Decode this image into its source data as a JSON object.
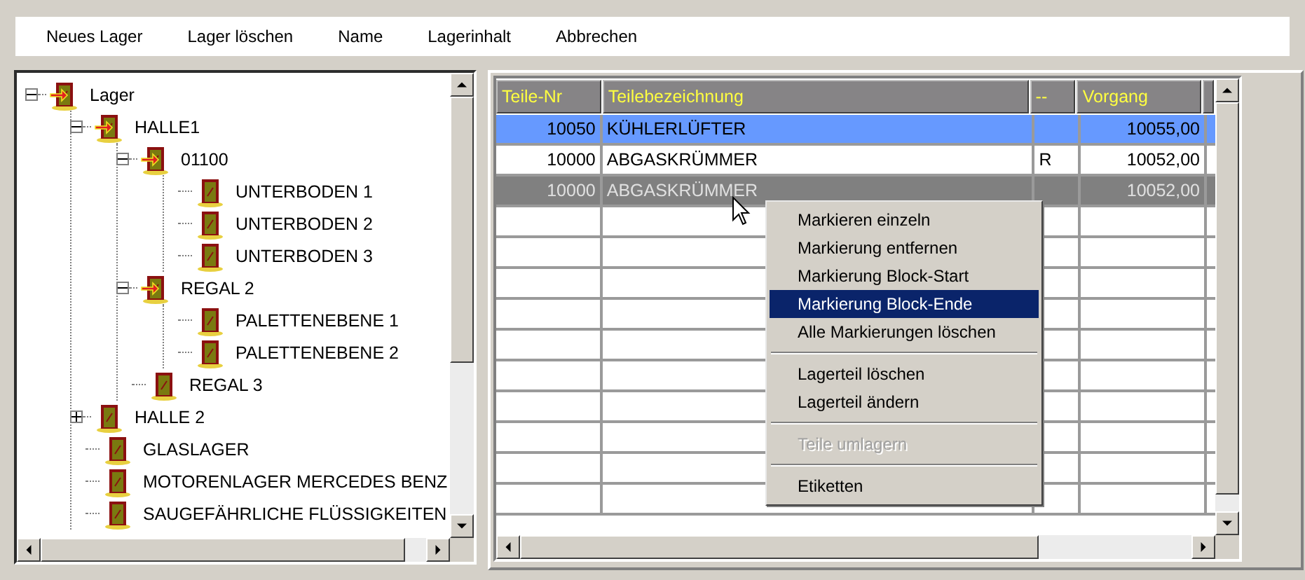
{
  "toolbar": [
    "Neues Lager",
    "Lager löschen",
    "Name",
    "Lagerinhalt",
    "Abbrechen"
  ],
  "tree": [
    {
      "label": "Lager",
      "kind": "branch",
      "expanded": true,
      "children": [
        {
          "label": "HALLE1",
          "kind": "branch",
          "expanded": true,
          "children": [
            {
              "label": "01100",
              "kind": "branch",
              "expanded": true,
              "children": [
                {
                  "label": "UNTERBODEN 1",
                  "kind": "leaf"
                },
                {
                  "label": "UNTERBODEN 2",
                  "kind": "leaf"
                },
                {
                  "label": "UNTERBODEN 3",
                  "kind": "leaf"
                }
              ]
            },
            {
              "label": "REGAL 2",
              "kind": "branch",
              "expanded": true,
              "children": [
                {
                  "label": "PALETTENEBENE 1",
                  "kind": "leaf"
                },
                {
                  "label": "PALETTENEBENE 2",
                  "kind": "leaf"
                }
              ]
            },
            {
              "label": "REGAL 3",
              "kind": "leaf"
            }
          ]
        },
        {
          "label": "HALLE 2",
          "kind": "branch",
          "expanded": false
        },
        {
          "label": "GLASLAGER",
          "kind": "leaf"
        },
        {
          "label": "MOTORENLAGER MERCEDES BENZ",
          "kind": "leaf"
        },
        {
          "label": "SAUGEFÄHRLICHE FLÜSSIGKEITEN",
          "kind": "leaf"
        }
      ]
    }
  ],
  "table": {
    "columns": [
      "Teile-Nr",
      "Teilebezeichnung",
      "--",
      "Vorgang"
    ],
    "rows": [
      {
        "nr": "10050",
        "name": "KÜHLERLÜFTER",
        "vorgang": "10055,00",
        "selected": true,
        "marked": false
      },
      {
        "nr": "10000",
        "name": "ABGASKRÜMMER",
        "flag": "R",
        "vorgang": "10052,00",
        "selected": false,
        "marked": false
      },
      {
        "nr": "10000",
        "name": "ABGASKRÜMMER",
        "vorgang": "10052,00",
        "selected": false,
        "marked": true
      }
    ]
  },
  "context_menu": [
    {
      "kind": "item",
      "label": "Markieren einzeln",
      "selected": false,
      "disabled": false
    },
    {
      "kind": "item",
      "label": "Markierung entfernen",
      "selected": false,
      "disabled": false
    },
    {
      "kind": "item",
      "label": "Markierung Block-Start",
      "selected": false,
      "disabled": false
    },
    {
      "kind": "item",
      "label": "Markierung Block-Ende",
      "selected": true,
      "disabled": false
    },
    {
      "kind": "item",
      "label": "Alle Markierungen löschen",
      "selected": false,
      "disabled": false
    },
    {
      "kind": "separator"
    },
    {
      "kind": "item",
      "label": "Lagerteil löschen",
      "selected": false,
      "disabled": false
    },
    {
      "kind": "item",
      "label": "Lagerteil ändern",
      "selected": false,
      "disabled": false
    },
    {
      "kind": "separator"
    },
    {
      "kind": "item",
      "label": "Teile umlagern",
      "selected": false,
      "disabled": true
    },
    {
      "kind": "separator"
    },
    {
      "kind": "item",
      "label": "Etiketten",
      "selected": false,
      "disabled": false
    }
  ]
}
